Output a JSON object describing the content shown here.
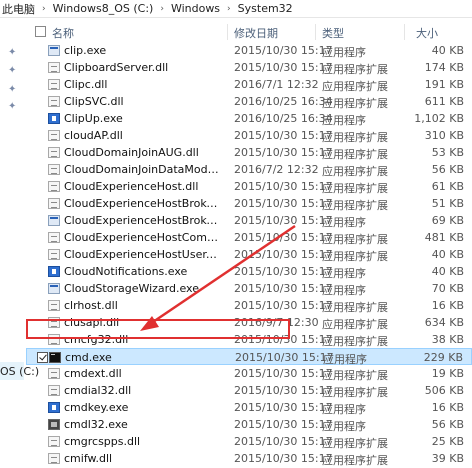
{
  "breadcrumb": [
    "此电脑",
    "Windows8_OS (C:)",
    "Windows",
    "System32"
  ],
  "header": {
    "name": "名称",
    "date": "修改日期",
    "type": "类型",
    "size": "大小"
  },
  "sidebar": {
    "drive_label": "OS (C:)"
  },
  "files": [
    {
      "name": "clip.exe",
      "date": "2015/10/30 15:17",
      "type": "应用程序",
      "size": "40 KB",
      "icon": "exe"
    },
    {
      "name": "ClipboardServer.dll",
      "date": "2015/10/30 15:17",
      "type": "应用程序扩展",
      "size": "174 KB",
      "icon": "dll"
    },
    {
      "name": "Clipc.dll",
      "date": "2016/7/1 12:32",
      "type": "应用程序扩展",
      "size": "191 KB",
      "icon": "dll"
    },
    {
      "name": "ClipSVC.dll",
      "date": "2016/10/25 16:34",
      "type": "应用程序扩展",
      "size": "611 KB",
      "icon": "dll"
    },
    {
      "name": "ClipUp.exe",
      "date": "2016/10/25 16:34",
      "type": "应用程序",
      "size": "1,102 KB",
      "icon": "blue"
    },
    {
      "name": "cloudAP.dll",
      "date": "2015/10/30 15:17",
      "type": "应用程序扩展",
      "size": "310 KB",
      "icon": "dll"
    },
    {
      "name": "CloudDomainJoinAUG.dll",
      "date": "2015/10/30 15:17",
      "type": "应用程序扩展",
      "size": "53 KB",
      "icon": "dll"
    },
    {
      "name": "CloudDomainJoinDataModelServe...",
      "date": "2016/7/2 12:32",
      "type": "应用程序扩展",
      "size": "56 KB",
      "icon": "dll"
    },
    {
      "name": "CloudExperienceHost.dll",
      "date": "2015/10/30 15:17",
      "type": "应用程序扩展",
      "size": "61 KB",
      "icon": "dll"
    },
    {
      "name": "CloudExperienceHostBroker.dll",
      "date": "2015/10/30 15:17",
      "type": "应用程序扩展",
      "size": "51 KB",
      "icon": "dll"
    },
    {
      "name": "CloudExperienceHostBroker.exe",
      "date": "2015/10/30 15:17",
      "type": "应用程序",
      "size": "69 KB",
      "icon": "exe"
    },
    {
      "name": "CloudExperienceHostCommon.dll",
      "date": "2015/10/30 15:17",
      "type": "应用程序扩展",
      "size": "481 KB",
      "icon": "dll"
    },
    {
      "name": "CloudExperienceHostUser.dll",
      "date": "2015/10/30 15:17",
      "type": "应用程序扩展",
      "size": "40 KB",
      "icon": "dll"
    },
    {
      "name": "CloudNotifications.exe",
      "date": "2015/10/30 15:17",
      "type": "应用程序",
      "size": "40 KB",
      "icon": "blue"
    },
    {
      "name": "CloudStorageWizard.exe",
      "date": "2015/10/30 15:17",
      "type": "应用程序",
      "size": "70 KB",
      "icon": "exe"
    },
    {
      "name": "clrhost.dll",
      "date": "2015/10/30 15:17",
      "type": "应用程序扩展",
      "size": "16 KB",
      "icon": "dll"
    },
    {
      "name": "clusapi.dll",
      "date": "2016/9/7 12:30",
      "type": "应用程序扩展",
      "size": "634 KB",
      "icon": "dll"
    },
    {
      "name": "cmcfg32.dll",
      "date": "2015/10/30 15:17",
      "type": "应用程序扩展",
      "size": "38 KB",
      "icon": "dll"
    },
    {
      "name": "cmd.exe",
      "date": "2015/10/30 15:17",
      "type": "应用程序",
      "size": "229 KB",
      "icon": "cmd",
      "selected": true
    },
    {
      "name": "cmdext.dll",
      "date": "2015/10/30 15:17",
      "type": "应用程序扩展",
      "size": "19 KB",
      "icon": "dll"
    },
    {
      "name": "cmdial32.dll",
      "date": "2015/10/30 15:17",
      "type": "应用程序扩展",
      "size": "506 KB",
      "icon": "dll"
    },
    {
      "name": "cmdkey.exe",
      "date": "2015/10/30 15:17",
      "type": "应用程序",
      "size": "16 KB",
      "icon": "blue"
    },
    {
      "name": "cmdl32.exe",
      "date": "2015/10/30 15:17",
      "type": "应用程序",
      "size": "56 KB",
      "icon": "cmd32"
    },
    {
      "name": "cmgrcspps.dll",
      "date": "2015/10/30 15:17",
      "type": "应用程序扩展",
      "size": "25 KB",
      "icon": "dll"
    },
    {
      "name": "cmifw.dll",
      "date": "2015/10/30 15:17",
      "type": "应用程序扩展",
      "size": "39 KB",
      "icon": "dll"
    }
  ],
  "colors": {
    "selection": "#cce8ff",
    "highlight_box": "#e03030",
    "header_text": "#4c607a"
  }
}
